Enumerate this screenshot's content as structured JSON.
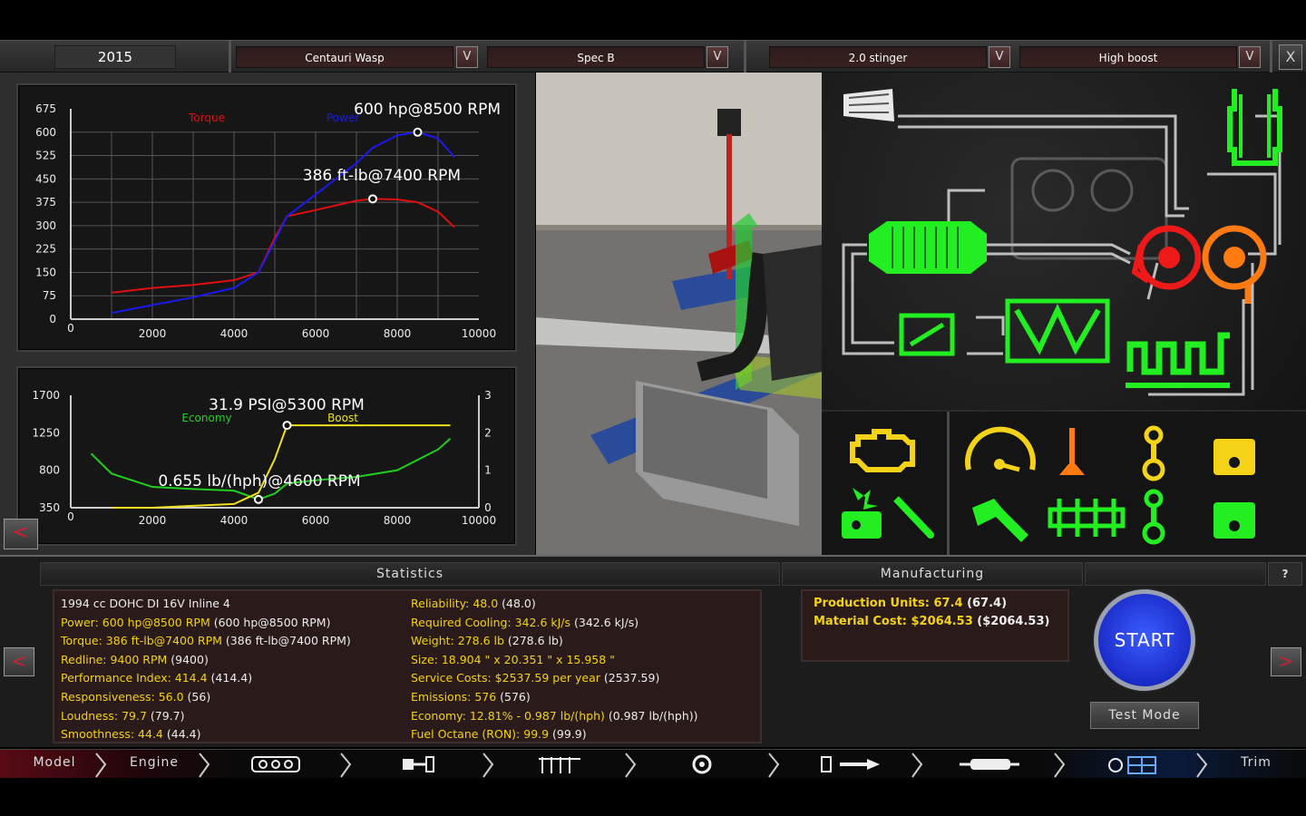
{
  "topbar": {
    "year": "2015",
    "model": "Centauri  Wasp",
    "trim": "Spec B",
    "engine": "2.0 stinger",
    "variant": "High boost",
    "dropdown_icon": "V",
    "close_icon": "X"
  },
  "power_chart": {
    "label_torque": "Torque",
    "label_power": "Power",
    "annotation_power": "600 hp@8500 RPM",
    "annotation_torque": "386 ft-lb@7400 RPM"
  },
  "boost_chart": {
    "label_economy": "Economy",
    "label_boost": "Boost",
    "annotation_boost": "31.9 PSI@5300 RPM",
    "annotation_economy": "0.655 lb/(hph)@4600 RPM"
  },
  "chart_data": [
    {
      "type": "line",
      "x": [
        1000,
        2000,
        3000,
        4000,
        4600,
        5000,
        5300,
        6000,
        7000,
        7400,
        8000,
        8500,
        9000,
        9400
      ],
      "series": [
        {
          "name": "Torque",
          "color": "#e01010",
          "values": [
            85,
            100,
            110,
            125,
            150,
            260,
            330,
            350,
            380,
            386,
            384,
            375,
            345,
            295
          ]
        },
        {
          "name": "Power",
          "color": "#1a1aee",
          "values": [
            20,
            45,
            70,
            100,
            150,
            250,
            330,
            400,
            500,
            550,
            590,
            600,
            580,
            520
          ]
        }
      ],
      "x_ticks": [
        0,
        2000,
        4000,
        6000,
        8000,
        10000
      ],
      "y_ticks": [
        0,
        75,
        150,
        225,
        300,
        375,
        450,
        525,
        600,
        675
      ],
      "xlim": [
        0,
        10000
      ],
      "ylim": [
        0,
        675
      ],
      "markers": [
        {
          "x": 8500,
          "y": 600
        },
        {
          "x": 7400,
          "y": 386
        }
      ],
      "grid": true
    },
    {
      "type": "line",
      "x": [
        500,
        1000,
        2000,
        3000,
        4000,
        4600,
        5000,
        5300,
        6000,
        7000,
        8000,
        9000,
        9300
      ],
      "series": [
        {
          "name": "Economy",
          "color": "#20d020",
          "axis": "left",
          "values": [
            1000,
            760,
            600,
            575,
            555,
            450,
            520,
            640,
            680,
            720,
            800,
            1050,
            1180
          ]
        },
        {
          "name": "Boost",
          "color": "#f0e020",
          "axis": "right",
          "values": [
            0,
            0,
            0,
            0.05,
            0.1,
            0.4,
            1.3,
            2.2,
            2.2,
            2.2,
            2.2,
            2.2,
            2.2
          ]
        }
      ],
      "x_ticks": [
        0,
        2000,
        4000,
        6000,
        8000,
        10000
      ],
      "y_ticks_left": [
        350,
        800,
        1250,
        1700
      ],
      "y_ticks_right": [
        0,
        1,
        2,
        3
      ],
      "xlim": [
        0,
        10000
      ],
      "ylim_left": [
        350,
        1700
      ],
      "ylim_right": [
        0,
        3
      ],
      "markers": [
        {
          "x": 5300,
          "y": 2.2,
          "axis": "right"
        },
        {
          "x": 4600,
          "y": 450,
          "axis": "left"
        }
      ],
      "grid": false
    }
  ],
  "statistics": {
    "header": "Statistics",
    "summary": "1994 cc DOHC DI 16V Inline 4",
    "left": [
      {
        "k": "Power: 600 hp@8500 RPM",
        "v": " (600 hp@8500 RPM)"
      },
      {
        "k": "Torque: 386 ft-lb@7400 RPM",
        "v": " (386 ft-lb@7400 RPM)"
      },
      {
        "k": "Redline: 9400 RPM",
        "v": " (9400)"
      },
      {
        "k": "Performance Index: 414.4",
        "v": " (414.4)"
      },
      {
        "k": "Responsiveness: 56.0",
        "v": " (56)"
      },
      {
        "k": "Loudness: 79.7",
        "v": " (79.7)"
      },
      {
        "k": "Smoothness: 44.4",
        "v": " (44.4)"
      }
    ],
    "right": [
      {
        "k": "Reliability: 48.0",
        "v": " (48.0)"
      },
      {
        "k": "Required Cooling: 342.6 kJ/s",
        "v": " (342.6 kJ/s)"
      },
      {
        "k": "Weight: 278.6 lb",
        "v": " (278.6 lb)"
      },
      {
        "k": "Size: 18.904 \" x 20.351 \" x 15.958 \"",
        "v": ""
      },
      {
        "k": "Service Costs: $2537.59 per year",
        "v": " (2537.59)"
      },
      {
        "k": "Emissions: 576",
        "v": " (576)"
      },
      {
        "k": "Economy: 12.81% - 0.987 lb/(hph)",
        "v": " (0.987 lb/(hph))"
      },
      {
        "k": "Fuel Octane (RON): 99.9",
        "v": " (99.9)"
      }
    ]
  },
  "manufacturing": {
    "header": "Manufacturing",
    "production_units": "Production Units: 67.4",
    "production_units_v": " (67.4)",
    "material_cost": "Material Cost: $2064.53",
    "material_cost_v": " ($2064.53)"
  },
  "buttons": {
    "start": "START",
    "test_mode": "Test Mode",
    "help": "?",
    "back": "<",
    "forward": ">"
  },
  "nav": {
    "model": "Model",
    "engine": "Engine",
    "trim": "Trim"
  },
  "colors": {
    "accent_yellow": "#f4d218",
    "schematic_green": "#22ee22",
    "schematic_red": "#ee1a1a",
    "schematic_orange": "#ff7a10",
    "start_blue": "#1a2cc8"
  }
}
